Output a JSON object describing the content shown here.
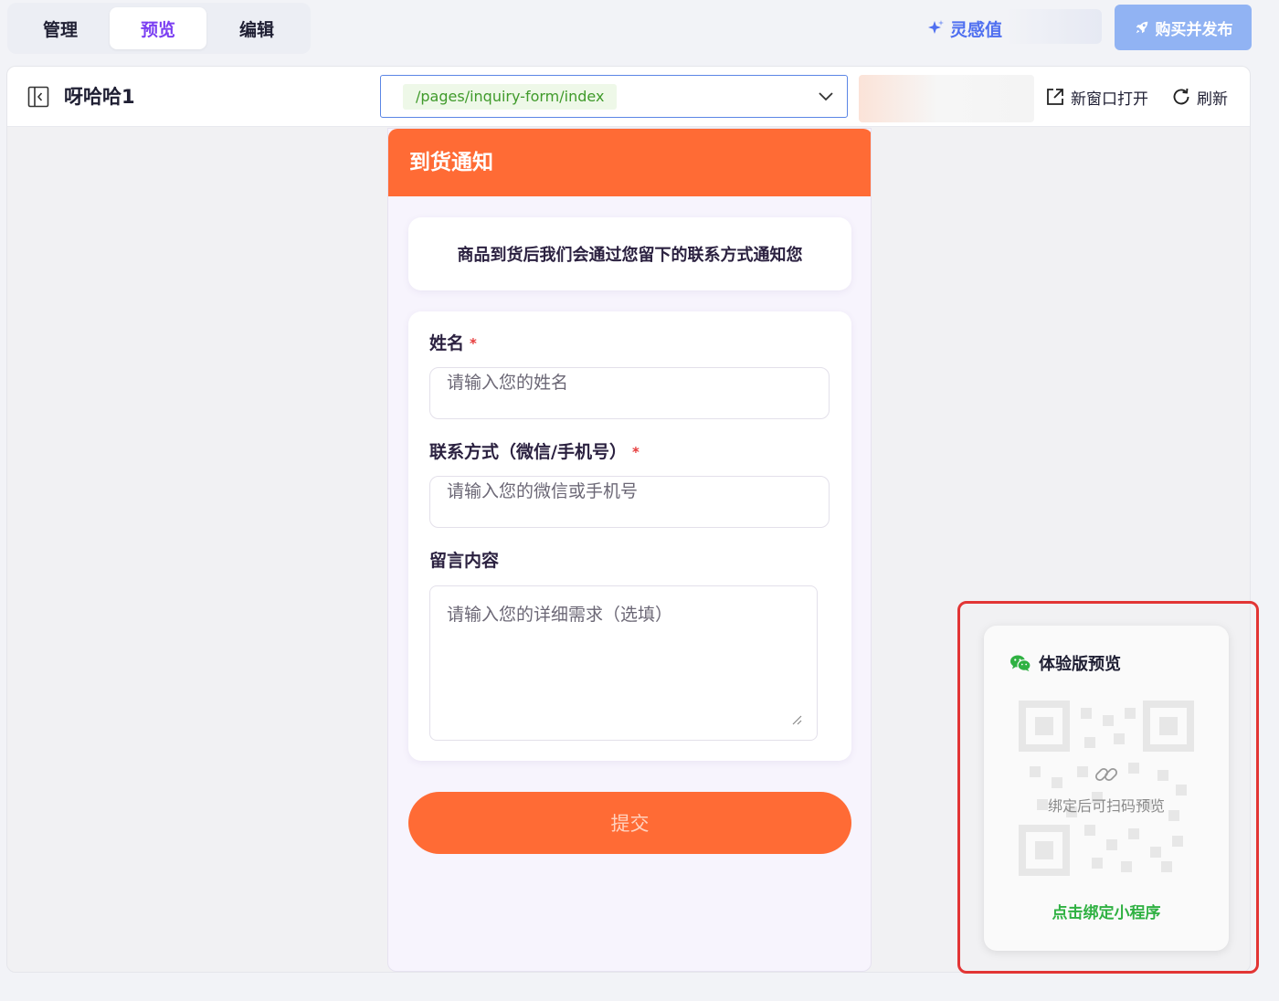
{
  "tabs": [
    {
      "label": "管理",
      "active": false
    },
    {
      "label": "预览",
      "active": true
    },
    {
      "label": "编辑",
      "active": false
    }
  ],
  "header": {
    "inspiration_label": "灵感值",
    "buy_button_label": "购买并发布",
    "accent_color": "#7b3ff2",
    "buy_button_color": "#91b3f3"
  },
  "toolbar": {
    "project_name": "呀哈哈1",
    "route_selected": "/pages/inquiry-form/index",
    "open_new_window_label": "新窗口打开",
    "refresh_label": "刷新",
    "icons": [
      "sidebar-toggle-icon",
      "chevron-down-icon",
      "external-link-icon",
      "refresh-icon"
    ]
  },
  "preview": {
    "header_title": "到货通知",
    "header_color": "#ff6b35",
    "notice_text": "商品到货后我们会通过您留下的联系方式通知您",
    "fields": [
      {
        "label": "姓名",
        "required_mark": "*",
        "placeholder": "请输入您的姓名"
      },
      {
        "label": "联系方式（微信/手机号）",
        "required_mark": "*",
        "placeholder": "请输入您的微信或手机号"
      },
      {
        "label": "留言内容",
        "required_mark": "",
        "placeholder": "请输入您的详细需求（选填）"
      }
    ],
    "submit_label": "提交"
  },
  "experience_preview": {
    "title": "体验版预览",
    "hint": "绑定后可扫码预览",
    "bind_link": "点击绑定小程序",
    "link_color": "#2fb142",
    "highlight_color": "#e23535",
    "icons": [
      "wechat-icon",
      "qr-code-placeholder",
      "link-icon"
    ]
  }
}
